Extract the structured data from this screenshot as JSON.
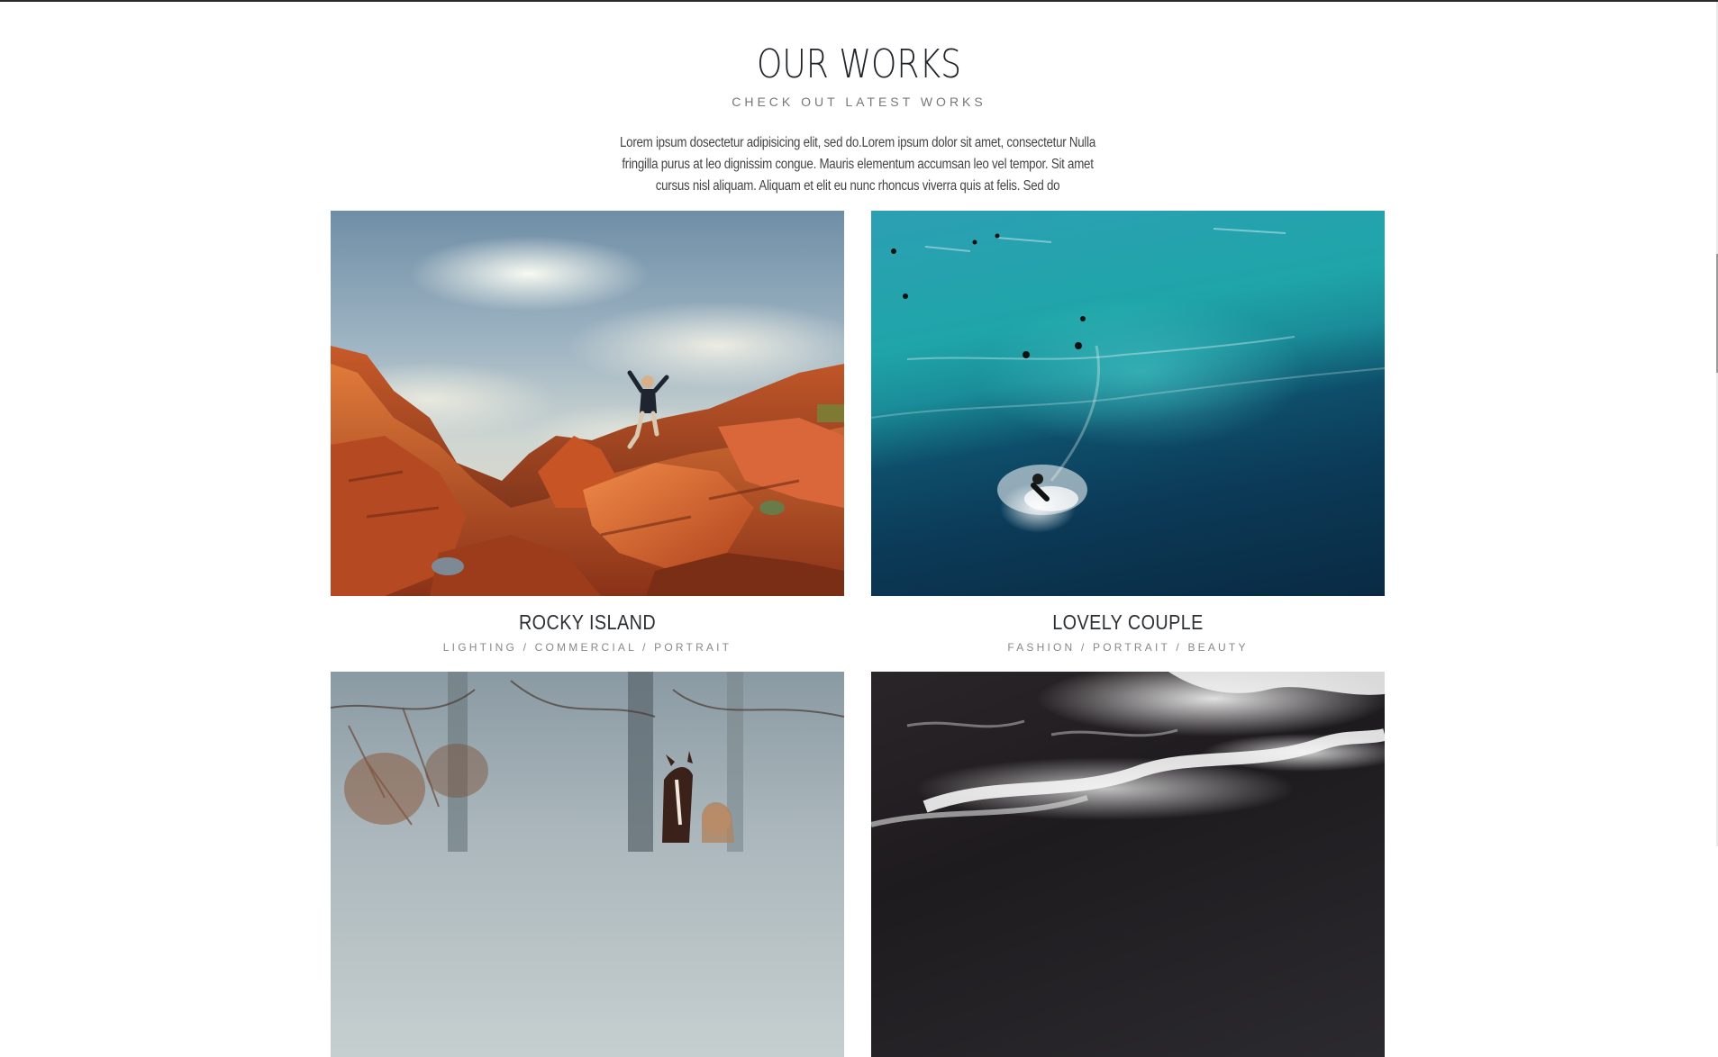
{
  "section": {
    "title": "OUR WORKS",
    "subtitle": "CHECK OUT LATEST WORKS",
    "intro": "Lorem ipsum dosectetur adipisicing elit, sed do.Lorem ipsum dolor sit amet, consectetur Nulla fringilla purus at leo dignissim congue. Mauris elementum accumsan leo vel tempor. Sit amet cursus nisl aliquam. Aliquam et elit eu nunc rhoncus viverra quis at felis. Sed do"
  },
  "works": [
    {
      "title": "ROCKY ISLAND",
      "tags": "LIGHTING / COMMERCIAL / PORTRAIT",
      "image": "canyon-rocks-person-jumping"
    },
    {
      "title": "LOVELY COUPLE",
      "tags": "FASHION / PORTRAIT / BEAUTY",
      "image": "ocean-surfers-aerial"
    },
    {
      "title": "",
      "tags": "",
      "image": "misty-forest-horse-woman"
    },
    {
      "title": "",
      "tags": "",
      "image": "dark-sea-waves-aerial"
    }
  ],
  "colors": {
    "title": "#1f2328",
    "subtitle": "#777777",
    "body_text": "#444444",
    "tags": "#888888",
    "background": "#ffffff"
  }
}
